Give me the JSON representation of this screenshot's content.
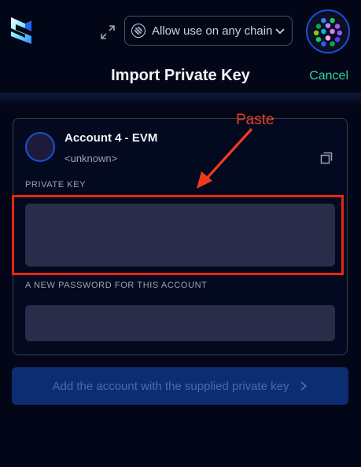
{
  "header": {
    "chain_selector": "Allow use on any chain",
    "title": "Import Private Key",
    "cancel": "Cancel"
  },
  "account": {
    "name": "Account 4 - EVM",
    "address": "<unknown>"
  },
  "form": {
    "private_key_label": "PRIVATE KEY",
    "private_key_value": "",
    "password_label": "A NEW PASSWORD FOR THIS ACCOUNT",
    "password_value": "",
    "submit_label": "Add the account with the supplied private key"
  },
  "annotation": {
    "text": "Paste",
    "color": "#ee3b1b"
  },
  "colors": {
    "accent": "#34d399",
    "brand_blue": "#1d4ed8",
    "input_bg": "#2a2d49"
  },
  "icons": [
    "logo",
    "expand-icon",
    "chain-icon",
    "chevron-down-icon",
    "avatar",
    "copy-icon",
    "chevron-right-icon"
  ]
}
